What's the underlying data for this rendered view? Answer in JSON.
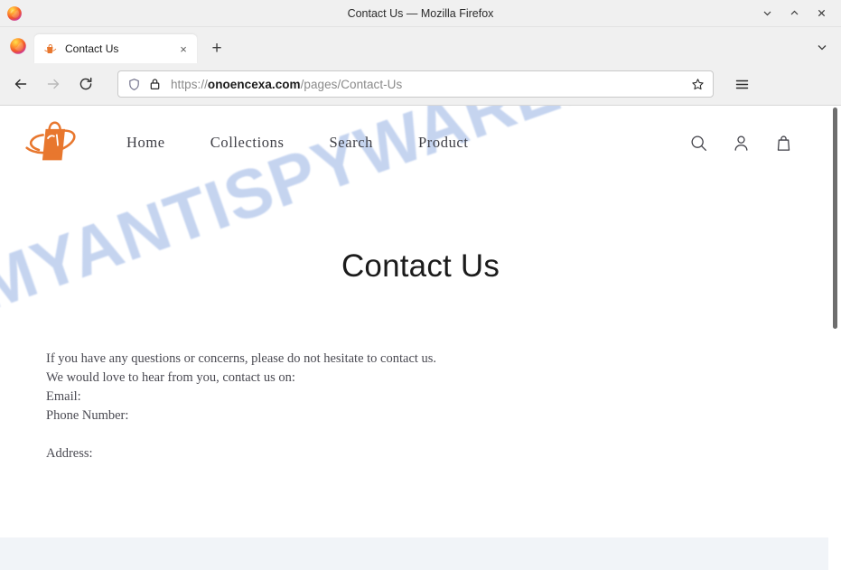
{
  "window": {
    "title": "Contact Us — Mozilla Firefox",
    "app_icon": "firefox-logo-icon",
    "controls": {
      "minimize": "chevron-down-icon",
      "maximize": "chevron-up-icon",
      "close": "close-icon"
    }
  },
  "tabbar": {
    "tabs": [
      {
        "title": "Contact Us",
        "favicon": "site-logo-favicon",
        "close_label": "×",
        "active": true
      }
    ],
    "new_tab_label": "+",
    "list_all_tabs_icon": "chevron-down-icon"
  },
  "toolbar": {
    "back_icon": "arrow-left-icon",
    "forward_icon": "arrow-right-icon",
    "reload_icon": "reload-icon",
    "shield_icon": "shield-icon",
    "lock_icon": "lock-icon",
    "bookmark_icon": "star-icon",
    "menu_icon": "hamburger-menu-icon",
    "url": {
      "scheme": "https://",
      "host": "onoencexa.com",
      "path": "/pages/Contact-Us",
      "full": "https://onoencexa.com/pages/Contact-Us"
    }
  },
  "site": {
    "logo_name": "shopping-bag-swoosh-logo",
    "logo_color": "#e8772e",
    "nav": [
      {
        "label": "Home"
      },
      {
        "label": "Collections"
      },
      {
        "label": "Search"
      },
      {
        "label": "Product"
      }
    ],
    "icons": [
      {
        "name": "search-icon"
      },
      {
        "name": "account-icon"
      },
      {
        "name": "cart-icon"
      }
    ]
  },
  "page": {
    "heading": "Contact Us",
    "lines": [
      "If you have any questions or concerns, please do not hesitate to contact us.",
      "We would love to hear from you, contact us on:",
      "Email:",
      "Phone Number:"
    ],
    "address_label": "Address:",
    "footer_band_color": "#f1f4f8"
  },
  "watermark": {
    "text": "MYANTISPYWARE.COM",
    "color": "#c2d2ef"
  }
}
